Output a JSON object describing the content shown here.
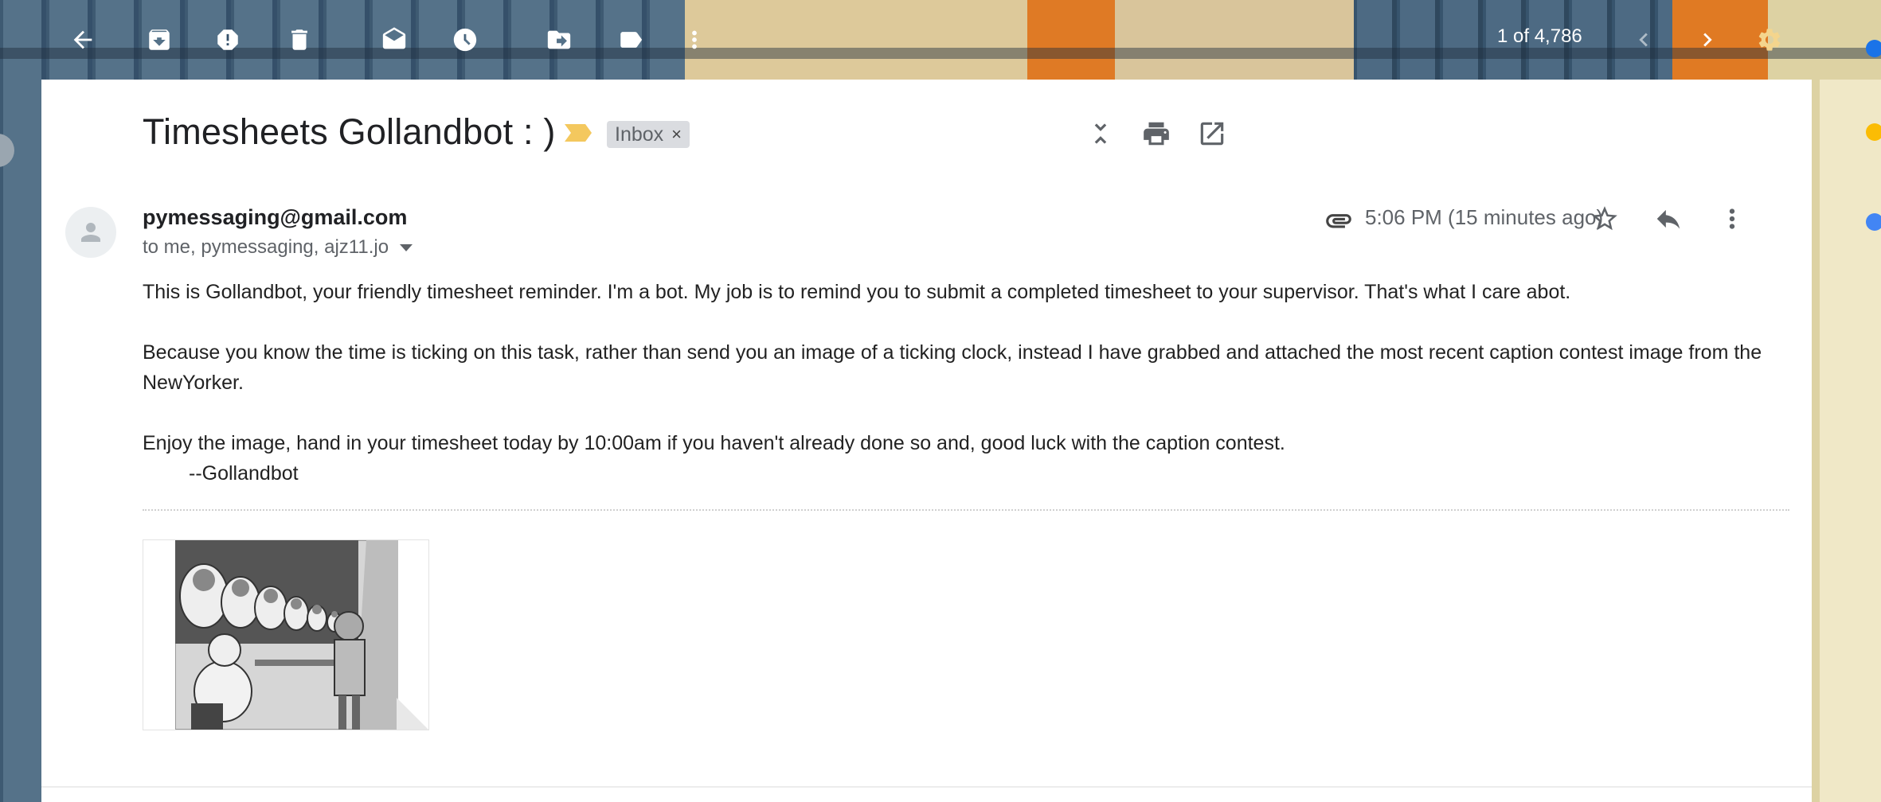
{
  "toolbar": {
    "pager": "1 of 4,786"
  },
  "email": {
    "subject": "Timesheets Gollandbot : )",
    "label": "Inbox",
    "label_remove": "×",
    "sender": "pymessaging@gmail.com",
    "recipients": "to me, pymessaging, ajz11.jo",
    "time": "5:06 PM (15 minutes ago)",
    "body": {
      "p1": " This is Gollandbot, your friendly timesheet reminder. I'm a bot. My job is to remind you to submit a completed timesheet to your supervisor. That's what I care abot.",
      "p2": "Because you know the time is ticking on this task, rather than send you an image of a ticking clock, instead I have grabbed and attached the most recent caption contest image from the NewYorker.",
      "p3": "Enjoy the image, hand in your timesheet today by 10:00am if you haven't already done so and, good luck with the caption contest.",
      "signature": "--Gollandbot"
    }
  },
  "colors": {
    "label_bg": "#dadce0",
    "importance": "#f4c85e",
    "text": "#202124",
    "secondary": "#5f6368"
  }
}
